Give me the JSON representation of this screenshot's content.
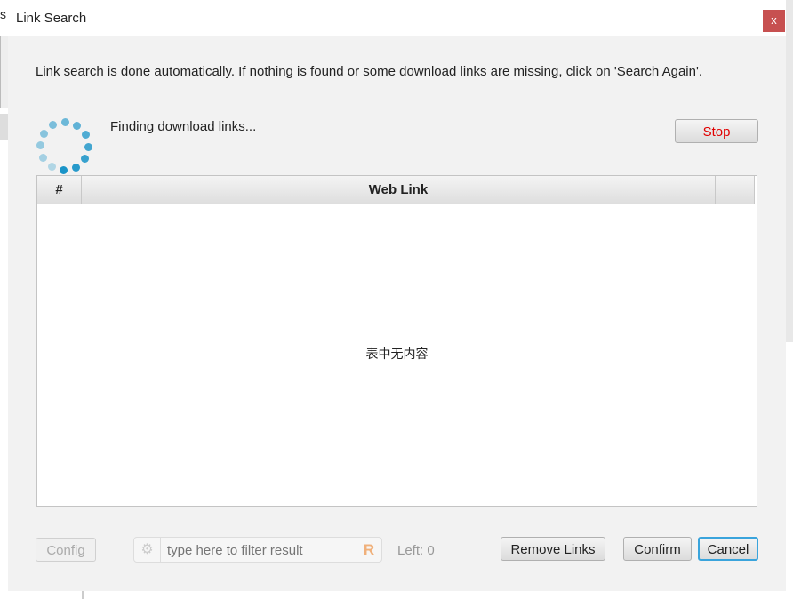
{
  "background": {
    "fragment": "s"
  },
  "dialog": {
    "title": "Link Search",
    "close_label": "x",
    "description": "Link search is done automatically. If nothing is found or some download links are missing, click on 'Search Again'.",
    "status": "Finding download links...",
    "stop_label": "Stop",
    "table": {
      "columns": [
        "#",
        "Web Link",
        ""
      ],
      "empty_text": "表中无内容"
    },
    "footer": {
      "config_label": "Config",
      "filter_placeholder": "type here to filter result",
      "filter_value": "",
      "regex_label": "R",
      "left_text": "Left: 0",
      "remove_label": "Remove Links",
      "confirm_label": "Confirm",
      "cancel_label": "Cancel"
    }
  },
  "colors": {
    "accent": "#1a94c8",
    "close": "#c75050",
    "stop": "#e00000"
  }
}
